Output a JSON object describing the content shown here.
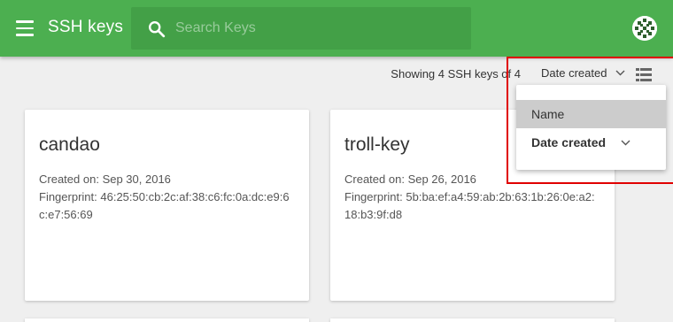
{
  "header": {
    "title": "SSH keys",
    "search_placeholder": "Search Keys",
    "bg_color": "#4caf50"
  },
  "toolbar": {
    "showing": "Showing 4 SSH keys of 4",
    "sort_label": "Date created"
  },
  "sort_menu": {
    "items": [
      {
        "label": "Name",
        "state": "hovered"
      },
      {
        "label": "Date created",
        "state": "selected"
      }
    ]
  },
  "cards": [
    {
      "title": "candao",
      "created_key": "Created on:",
      "created_value": "Sep 30, 2016",
      "fingerprint_key": "Fingerprint:",
      "fingerprint_value": "46:25:50:cb:2c:af:38:c6:fc:0a:dc:e9:6c:e7:56:69"
    },
    {
      "title": "troll-key",
      "created_key": "Created on:",
      "created_value": "Sep 26, 2016",
      "fingerprint_key": "Fingerprint:",
      "fingerprint_value": "5b:ba:ef:a4:59:ab:2b:63:1b:26:0e:a2:18:b3:9f:d8"
    }
  ],
  "icons": {
    "menu": "menu-icon",
    "search": "search-icon",
    "avatar": "avatar-icon",
    "chevron": "chevron-down-icon",
    "view": "list-view-icon"
  },
  "annotation_color": "#e00000"
}
